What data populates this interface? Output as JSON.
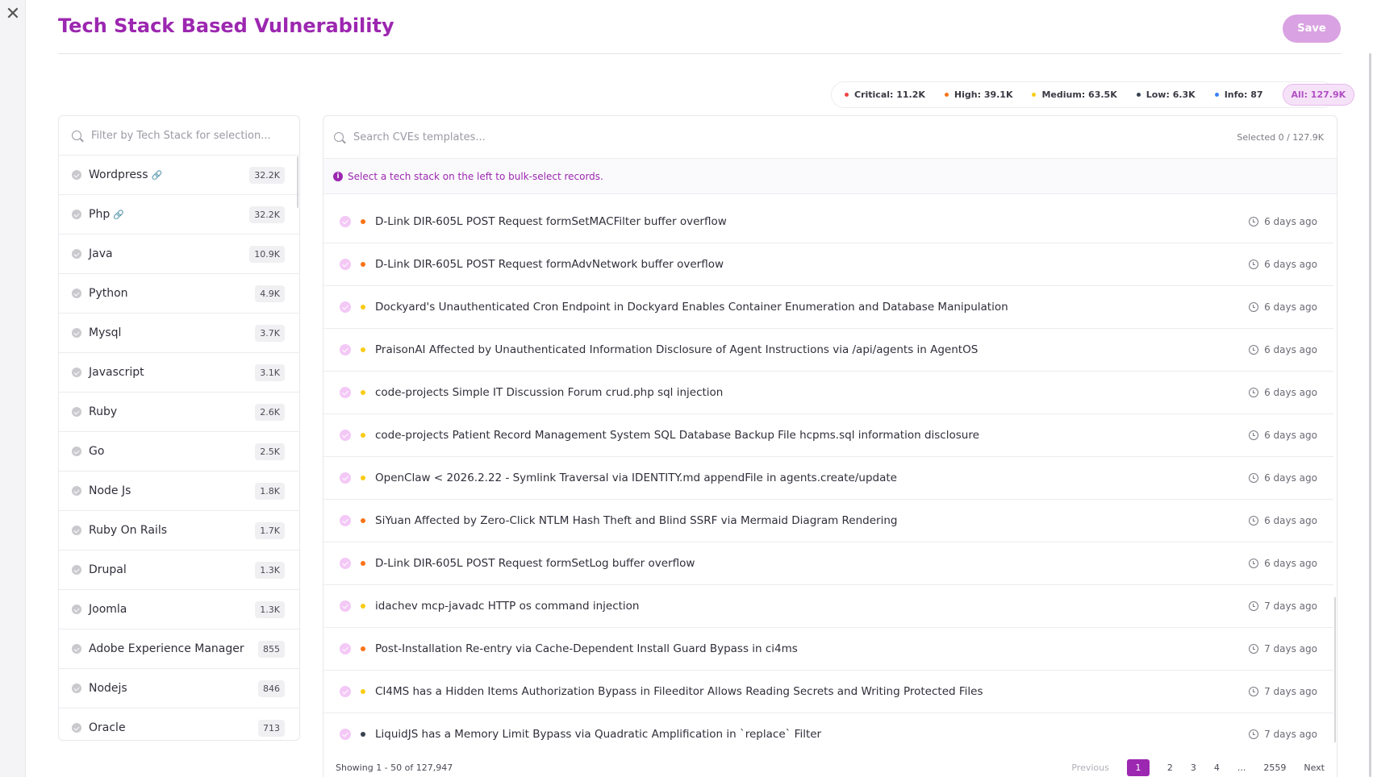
{
  "header": {
    "title": "Tech Stack Based Vulnerability",
    "save_label": "Save",
    "close_icon": "close-icon"
  },
  "severity_summary": [
    {
      "label": "Critical: 11.2K",
      "color": "#ef4444"
    },
    {
      "label": "High: 39.1K",
      "color": "#f97316"
    },
    {
      "label": "Medium: 63.5K",
      "color": "#facc15"
    },
    {
      "label": "Low: 6.3K",
      "color": "#374151"
    },
    {
      "label": "Info: 87",
      "color": "#3b82f6"
    }
  ],
  "severity_all": "All: 127.9K",
  "stack_filter": {
    "placeholder": "Filter by Tech Stack for selection...",
    "items": [
      {
        "name": "Wordpress",
        "count": "32.2K",
        "linked": true
      },
      {
        "name": "Php",
        "count": "32.2K",
        "linked": true
      },
      {
        "name": "Java",
        "count": "10.9K",
        "linked": false
      },
      {
        "name": "Python",
        "count": "4.9K",
        "linked": false
      },
      {
        "name": "Mysql",
        "count": "3.7K",
        "linked": false
      },
      {
        "name": "Javascript",
        "count": "3.1K",
        "linked": false
      },
      {
        "name": "Ruby",
        "count": "2.6K",
        "linked": false
      },
      {
        "name": "Go",
        "count": "2.5K",
        "linked": false
      },
      {
        "name": "Node Js",
        "count": "1.8K",
        "linked": false
      },
      {
        "name": "Ruby On Rails",
        "count": "1.7K",
        "linked": false
      },
      {
        "name": "Drupal",
        "count": "1.3K",
        "linked": false
      },
      {
        "name": "Joomla",
        "count": "1.3K",
        "linked": false
      },
      {
        "name": "Adobe Experience Manager",
        "count": "855",
        "linked": false
      },
      {
        "name": "Nodejs",
        "count": "846",
        "linked": false
      },
      {
        "name": "Oracle",
        "count": "713",
        "linked": false
      }
    ]
  },
  "cve_search": {
    "placeholder": "Search CVEs templates...",
    "selected": "Selected 0 / 127.9K"
  },
  "info_banner": "Select a tech stack on the left to bulk-select records.",
  "cves": [
    {
      "title": "D-Link DIR-605L POST Request formSetMACFilter buffer overflow",
      "severity": "#f97316",
      "time": "6 days ago"
    },
    {
      "title": "D-Link DIR-605L POST Request formAdvNetwork buffer overflow",
      "severity": "#f97316",
      "time": "6 days ago"
    },
    {
      "title": "Dockyard's Unauthenticated Cron Endpoint in Dockyard Enables Container Enumeration and Database Manipulation",
      "severity": "#facc15",
      "time": "6 days ago"
    },
    {
      "title": "PraisonAI Affected by Unauthenticated Information Disclosure of Agent Instructions via /api/agents in AgentOS",
      "severity": "#facc15",
      "time": "6 days ago"
    },
    {
      "title": "code-projects Simple IT Discussion Forum crud.php sql injection",
      "severity": "#facc15",
      "time": "6 days ago"
    },
    {
      "title": "code-projects Patient Record Management System SQL Database Backup File hcpms.sql information disclosure",
      "severity": "#facc15",
      "time": "6 days ago"
    },
    {
      "title": "OpenClaw < 2026.2.22 - Symlink Traversal via IDENTITY.md appendFile in agents.create/update",
      "severity": "#facc15",
      "time": "6 days ago"
    },
    {
      "title": "SiYuan Affected by Zero-Click NTLM Hash Theft and Blind SSRF via Mermaid Diagram Rendering",
      "severity": "#f97316",
      "time": "6 days ago"
    },
    {
      "title": "D-Link DIR-605L POST Request formSetLog buffer overflow",
      "severity": "#f97316",
      "time": "6 days ago"
    },
    {
      "title": "idachev mcp-javadc HTTP os command injection",
      "severity": "#facc15",
      "time": "7 days ago"
    },
    {
      "title": "Post-Installation Re-entry via Cache-Dependent Install Guard Bypass in ci4ms",
      "severity": "#f97316",
      "time": "7 days ago"
    },
    {
      "title": "CI4MS has a Hidden Items Authorization Bypass in Fileeditor Allows Reading Secrets and Writing Protected Files",
      "severity": "#facc15",
      "time": "7 days ago"
    },
    {
      "title": "LiquidJS has a Memory Limit Bypass via Quadratic Amplification in `replace` Filter",
      "severity": "#374151",
      "time": "7 days ago"
    }
  ],
  "pagination": {
    "showing": "Showing 1 - 50 of 127,947",
    "previous": "Previous",
    "pages": [
      "1",
      "2",
      "3",
      "4",
      "...",
      "2559"
    ],
    "next": "Next",
    "active": "1"
  }
}
